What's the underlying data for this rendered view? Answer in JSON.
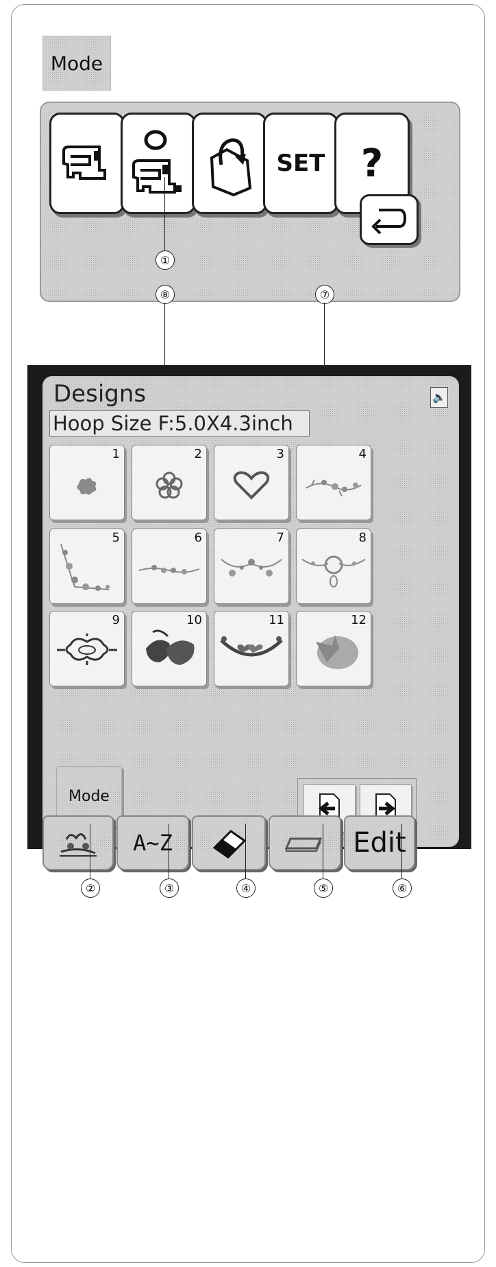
{
  "top_mode_label": "Mode",
  "toolbar": {
    "buttons": [
      {
        "icon": "sewing-machine-icon"
      },
      {
        "icon": "embroidery-machine-icon"
      },
      {
        "icon": "file-folder-icon"
      },
      {
        "label": "SET"
      },
      {
        "label": "?"
      }
    ],
    "back_icon": "return-arrow-icon"
  },
  "callouts": [
    "①",
    "②",
    "③",
    "④",
    "⑤",
    "⑥",
    "⑦",
    "⑧"
  ],
  "screen": {
    "title": "Designs",
    "hoop_size": "Hoop Size  F:5.0X4.3inch",
    "speaker_icon": "speaker-icon",
    "designs": [
      {
        "number": "1",
        "motif": "small-flower"
      },
      {
        "number": "2",
        "motif": "flower-outline"
      },
      {
        "number": "3",
        "motif": "heart"
      },
      {
        "number": "4",
        "motif": "floral-border"
      },
      {
        "number": "5",
        "motif": "floral-corner"
      },
      {
        "number": "6",
        "motif": "floral-vine"
      },
      {
        "number": "7",
        "motif": "floral-swag"
      },
      {
        "number": "8",
        "motif": "floral-wreath"
      },
      {
        "number": "9",
        "motif": "scroll-ornament"
      },
      {
        "number": "10",
        "motif": "leaves"
      },
      {
        "number": "11",
        "motif": "heart-garland"
      },
      {
        "number": "12",
        "motif": "starfish"
      }
    ],
    "mode_label": "Mode",
    "page_buttons": [
      "prev-page-icon",
      "next-page-icon"
    ],
    "tabs": [
      {
        "icon": "embroidery-designs-icon"
      },
      {
        "label": "A~Z"
      },
      {
        "icon": "eraser-icon"
      },
      {
        "icon": "hoop-icon"
      },
      {
        "label": "Edit"
      }
    ]
  }
}
